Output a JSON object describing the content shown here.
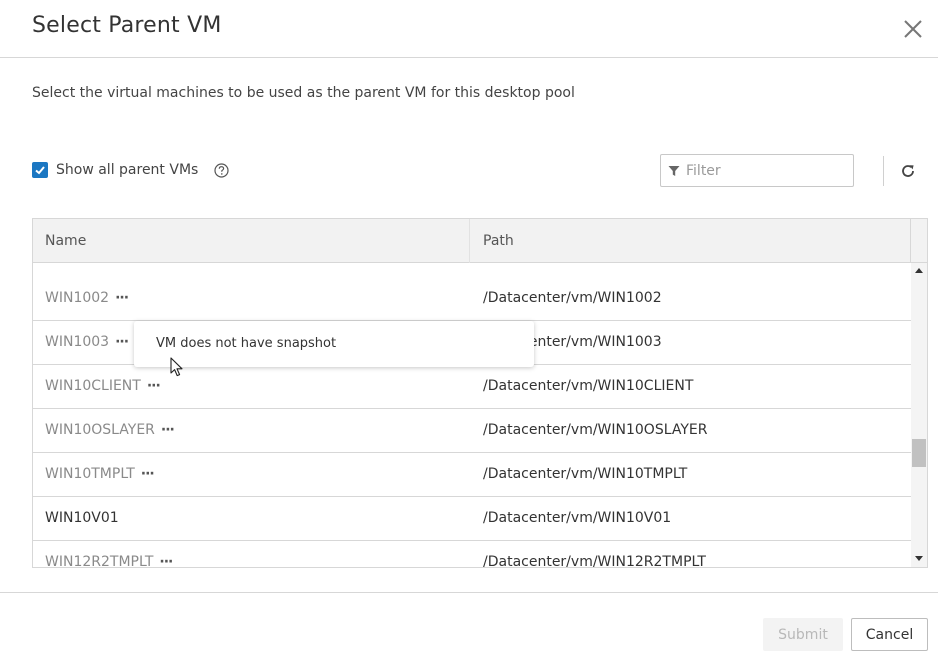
{
  "dialog": {
    "title": "Select Parent VM",
    "description": "Select the virtual machines to be used as the parent VM for this desktop pool"
  },
  "toolbar": {
    "show_all_label": "Show all parent VMs",
    "show_all_checked": true,
    "filter_placeholder": "Filter",
    "icons": [
      "close-icon",
      "check-icon",
      "help-icon",
      "filter-icon",
      "refresh-icon"
    ]
  },
  "table": {
    "columns": [
      "Name",
      "Path"
    ],
    "rows": [
      {
        "name": "WIN1002",
        "path": "/Datacenter/vm/WIN1002",
        "has_more": true,
        "disabled": true
      },
      {
        "name": "WIN1003",
        "path": "/Datacenter/vm/WIN1003",
        "has_more": true,
        "disabled": true
      },
      {
        "name": "WIN10CLIENT",
        "path": "/Datacenter/vm/WIN10CLIENT",
        "has_more": true,
        "disabled": true
      },
      {
        "name": "WIN10OSLAYER",
        "path": "/Datacenter/vm/WIN10OSLAYER",
        "has_more": true,
        "disabled": true
      },
      {
        "name": "WIN10TMPLT",
        "path": "/Datacenter/vm/WIN10TMPLT",
        "has_more": true,
        "disabled": true
      },
      {
        "name": "WIN10V01",
        "path": "/Datacenter/vm/WIN10V01",
        "has_more": false,
        "disabled": false
      },
      {
        "name": "WIN12R2TMPLT",
        "path": "/Datacenter/vm/WIN12R2TMPLT",
        "has_more": true,
        "disabled": true
      }
    ],
    "more_glyph": "···"
  },
  "tooltip": {
    "text": "VM does not have snapshot"
  },
  "footer": {
    "submit_label": "Submit",
    "cancel_label": "Cancel"
  },
  "colors": {
    "accent": "#1b77c2",
    "disabled_text": "#8a8a8a"
  }
}
